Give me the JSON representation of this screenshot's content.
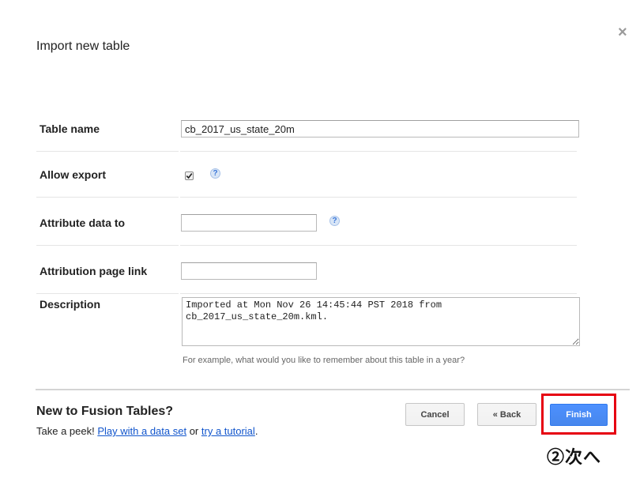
{
  "dialog": {
    "title": "Import new table",
    "close_glyph": "×"
  },
  "form": {
    "table_name": {
      "label": "Table name",
      "value": "cb_2017_us_state_20m"
    },
    "allow_export": {
      "label": "Allow export",
      "checked": true,
      "help_glyph": "?"
    },
    "attribute_data_to": {
      "label": "Attribute data to",
      "value": "",
      "help_glyph": "?"
    },
    "attribution_page_link": {
      "label": "Attribution page link",
      "value": ""
    },
    "description": {
      "label": "Description",
      "value": "Imported at Mon Nov 26 14:45:44 PST 2018 from cb_2017_us_state_20m.kml.",
      "hint": "For example, what would you like to remember about this table in a year?"
    }
  },
  "footer": {
    "promo_title": "New to Fusion Tables?",
    "promo_prefix": "Take a peek!",
    "link_data_set": "Play with a data set",
    "promo_or": "or",
    "link_tutorial": "try a tutorial",
    "promo_suffix": ".",
    "cancel_label": "Cancel",
    "back_label": "« Back",
    "finish_label": "Finish"
  },
  "annotation": {
    "text": "②次へ",
    "highlight_color": "#e60012"
  },
  "colors": {
    "primary_button": "#4d90fe",
    "link": "#1155cc"
  }
}
